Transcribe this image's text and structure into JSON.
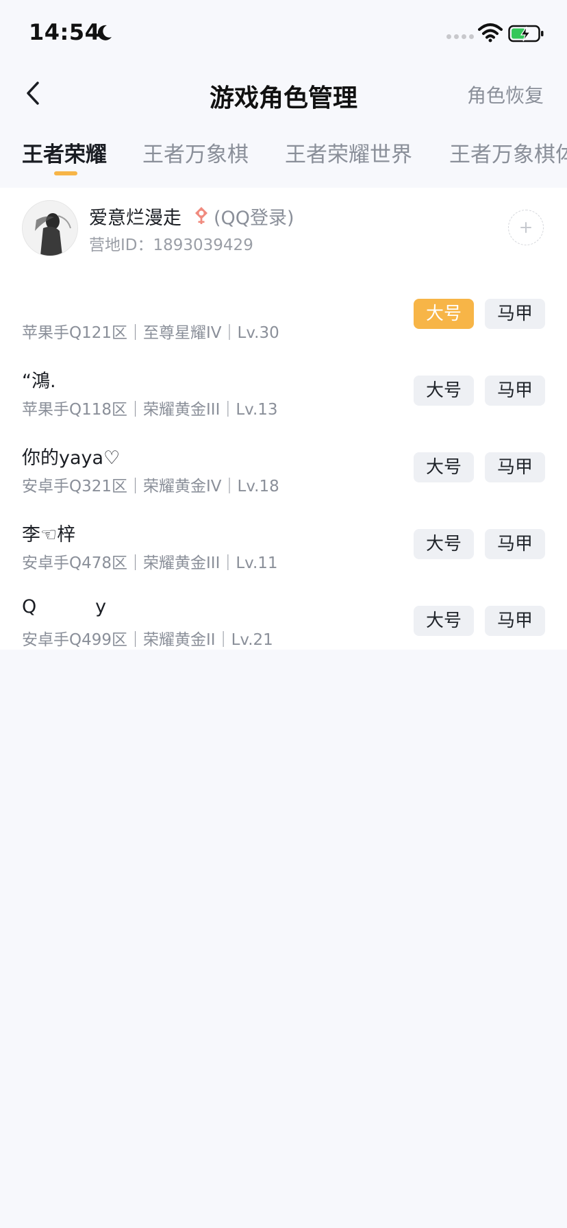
{
  "status_bar": {
    "time": "14:54"
  },
  "nav": {
    "title": "游戏角色管理",
    "action": "角色恢复"
  },
  "tabs": [
    {
      "label": "王者荣耀",
      "active": true
    },
    {
      "label": "王者万象棋",
      "active": false
    },
    {
      "label": "王者荣耀世界",
      "active": false
    },
    {
      "label": "王者万象棋体",
      "active": false
    }
  ],
  "account": {
    "name": "爱意烂漫走",
    "login_type": "(QQ登录)",
    "camp_id": "营地ID：1893039429"
  },
  "buttons": {
    "main_label": "大号",
    "alt_label": "马甲"
  },
  "roles": [
    {
      "name": "",
      "meta": "苹果手Q121区｜至尊星耀IV｜Lv.30",
      "selected": "main"
    },
    {
      "name": "“鴻.",
      "meta": "苹果手Q118区｜荣耀黄金III｜Lv.13",
      "selected": "none"
    },
    {
      "name": "你的yaya♡",
      "meta": "安卓手Q321区｜荣耀黄金IV｜Lv.18",
      "selected": "none"
    },
    {
      "name": "李☜梓",
      "meta": "安卓手Q478区｜荣耀黄金III｜Lv.11",
      "selected": "none"
    },
    {
      "name": "Q          y",
      "meta": "安卓手Q499区｜荣耀黄金II｜Lv.21",
      "selected": "none"
    }
  ],
  "colors": {
    "accent": "#f7b547",
    "background": "#f7f8fc",
    "tag_background": "#eef0f4",
    "secondary_text": "#8a8f99"
  },
  "icons": {
    "back": "chevron-left-icon",
    "add": "plus-icon",
    "gender": "female-icon",
    "moon": "moon-icon",
    "wifi": "wifi-icon",
    "battery": "battery-charging-icon"
  }
}
